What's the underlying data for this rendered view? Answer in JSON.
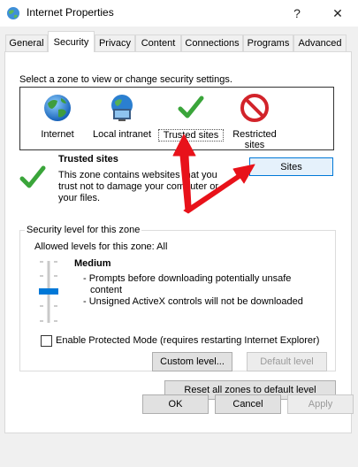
{
  "window": {
    "title": "Internet Properties",
    "help_glyph": "?",
    "close_glyph": "✕"
  },
  "tabs": [
    {
      "label": "General"
    },
    {
      "label": "Security"
    },
    {
      "label": "Privacy"
    },
    {
      "label": "Content"
    },
    {
      "label": "Connections"
    },
    {
      "label": "Programs"
    },
    {
      "label": "Advanced"
    }
  ],
  "security": {
    "select_prompt": "Select a zone to view or change security settings.",
    "zones": [
      {
        "line1": "Internet",
        "line2": "",
        "icon": "globe-icon"
      },
      {
        "line1": "Local intranet",
        "line2": "",
        "icon": "intranet-icon"
      },
      {
        "line1": "Trusted sites",
        "line2": "",
        "icon": "checkmark-icon"
      },
      {
        "line1": "Restricted",
        "line2": "sites",
        "icon": "no-entry-icon"
      }
    ],
    "selected_zone": {
      "name": "Trusted sites",
      "desc_line1": "This zone contains websites that you",
      "desc_line2": "trust not to damage your computer or",
      "desc_line3": "your files."
    },
    "sites_button": "Sites",
    "level_group": {
      "legend": "Security level for this zone",
      "allowed": "Allowed levels for this zone: All",
      "level_name": "Medium",
      "bullet1_line1": "- Prompts before downloading potentially unsafe",
      "bullet1_line2": "content",
      "bullet2": "- Unsigned ActiveX controls will not be downloaded",
      "slider_level": "Medium",
      "protected_mode_label": "Enable Protected Mode (requires restarting Internet Explorer)",
      "protected_mode_checked": false,
      "custom_level_button": "Custom level...",
      "default_level_button": "Default level"
    },
    "reset_button": "Reset all zones to default level"
  },
  "footer": {
    "ok": "OK",
    "cancel": "Cancel",
    "apply": "Apply"
  },
  "colors": {
    "accent": "#0078d7",
    "annotation_arrow": "#e8121a",
    "check_green": "#3aa53a"
  }
}
